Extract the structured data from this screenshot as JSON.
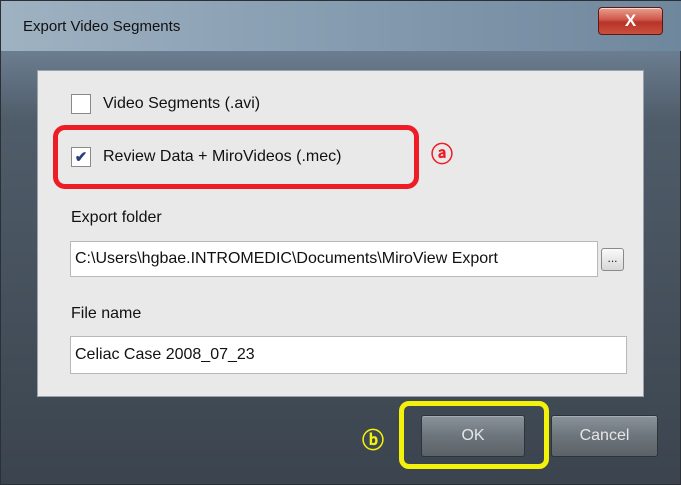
{
  "window": {
    "title": "Export Video Segments",
    "close_label": "X"
  },
  "options": [
    {
      "label": "Video Segments (.avi)",
      "checked": false,
      "check_glyph": ""
    },
    {
      "label": "Review Data + MiroVideos (.mec)",
      "checked": true,
      "check_glyph": "✔"
    }
  ],
  "export_folder": {
    "label": "Export folder",
    "value": "C:\\Users\\hgbae.INTROMEDIC\\Documents\\MiroView Export",
    "browse_label": "..."
  },
  "file_name": {
    "label": "File name",
    "value": "Celiac Case 2008_07_23"
  },
  "buttons": {
    "ok": "OK",
    "cancel": "Cancel"
  },
  "annotations": {
    "a": "ⓐ",
    "b": "ⓑ",
    "red": "#ee1c24",
    "yellow": "#f2f20a"
  }
}
